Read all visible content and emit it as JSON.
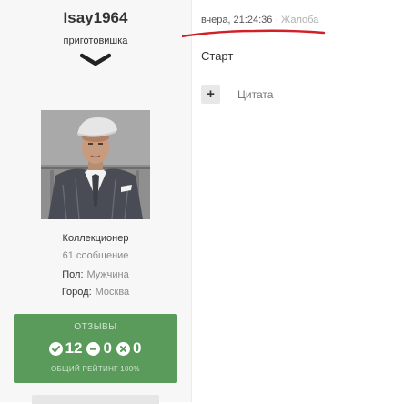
{
  "author": {
    "username": "Isay1964",
    "title": "приготовишка",
    "rank": "Коллекционер",
    "posts": "61 сообщение",
    "fields": [
      {
        "label": "Пол:",
        "value": "Мужчина"
      },
      {
        "label": "Город:",
        "value": "Москва"
      }
    ]
  },
  "reputation": {
    "title": "ОТЗЫВЫ",
    "positive": "12",
    "neutral": "0",
    "negative": "0",
    "overall": "ОБЩИЙ РЕЙТИНГ 100%"
  },
  "post": {
    "date": "вчера, 21:24:36",
    "separator": "·",
    "report": "Жалоба",
    "content": "Старт",
    "plus": "+",
    "quote": "Цитата"
  },
  "colors": {
    "accent_red": "#d0202a",
    "rep_green": "#5a9b5c"
  },
  "icons": {
    "chevron": "chevron-down-icon",
    "positive": "check-circle-icon",
    "neutral": "minus-circle-icon",
    "negative": "times-circle-icon"
  }
}
